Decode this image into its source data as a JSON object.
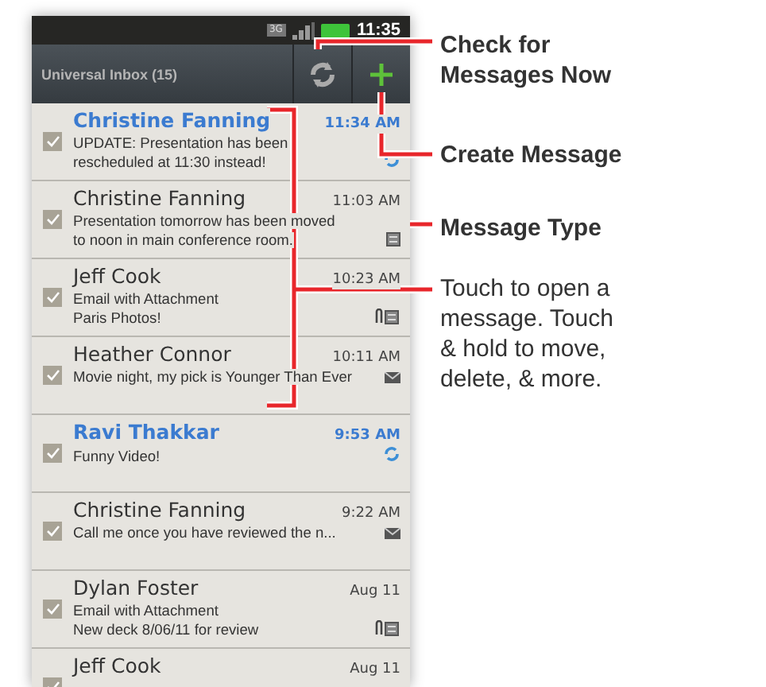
{
  "status_bar": {
    "network": "3G",
    "time": "11:35"
  },
  "header": {
    "title": "Universal Inbox (15)"
  },
  "messages": [
    {
      "sender": "Christine Fanning",
      "lines": [
        "UPDATE:  Presentation has been",
        "rescheduled at 11:30 instead!"
      ],
      "time": "11:34 AM",
      "unread": true,
      "checked": true,
      "kind": "sync"
    },
    {
      "sender": "Christine Fanning",
      "lines": [
        "Presentation tomorrow has been moved",
        "to noon in main conference room."
      ],
      "time": "11:03 AM",
      "unread": false,
      "checked": true,
      "kind": "message"
    },
    {
      "sender": "Jeff Cook",
      "lines": [
        "Email with Attachment",
        "Paris Photos!"
      ],
      "time": "10:23 AM",
      "unread": false,
      "checked": true,
      "kind": "attachment"
    },
    {
      "sender": "Heather Connor",
      "lines": [
        "Movie night, my pick is Younger Than Ever"
      ],
      "time": "10:11 AM",
      "unread": false,
      "checked": true,
      "kind": "email"
    },
    {
      "sender": "Ravi Thakkar",
      "lines": [
        "Funny Video!"
      ],
      "time": "9:53 AM",
      "unread": true,
      "checked": true,
      "kind": "sync"
    },
    {
      "sender": "Christine Fanning",
      "lines": [
        "Call me once you have reviewed the n..."
      ],
      "time": "9:22 AM",
      "unread": false,
      "checked": true,
      "kind": "email"
    },
    {
      "sender": "Dylan Foster",
      "lines": [
        "Email with Attachment",
        "New deck 8/06/11 for review"
      ],
      "time": "Aug 11",
      "unread": false,
      "checked": true,
      "kind": "attachment"
    },
    {
      "sender": "Jeff Cook",
      "time": "Aug 11",
      "unread": false,
      "checked": true,
      "kind": "none"
    }
  ],
  "callouts": [
    {
      "text": "Check for Messages Now",
      "kind": "heading"
    },
    {
      "text": "Create Message",
      "kind": "heading"
    },
    {
      "text": "Message Type",
      "kind": "heading"
    },
    {
      "text": "Touch to open a message. Touch & hold to move, delete, & more.",
      "kind": "note"
    }
  ]
}
